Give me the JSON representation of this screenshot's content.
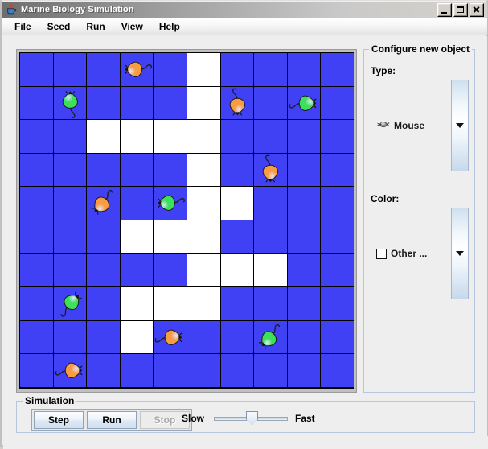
{
  "window": {
    "title": "Marine Biology Simulation",
    "icon": "java-coffee-cup-icon",
    "buttons": {
      "minimize": "minimize-button",
      "maximize": "maximize-button",
      "close": "close-button"
    }
  },
  "menubar": {
    "items": [
      {
        "label": "File"
      },
      {
        "label": "Seed"
      },
      {
        "label": "Run"
      },
      {
        "label": "View"
      },
      {
        "label": "Help"
      }
    ]
  },
  "grid": {
    "rows": 10,
    "cols": 10,
    "cell_color": "#4040f5",
    "empty_color": "#ffffff",
    "border_color": "#000000",
    "white_cells": [
      [
        0,
        5
      ],
      [
        1,
        5
      ],
      [
        2,
        2
      ],
      [
        2,
        3
      ],
      [
        2,
        4
      ],
      [
        2,
        5
      ],
      [
        3,
        5
      ],
      [
        4,
        5
      ],
      [
        4,
        6
      ],
      [
        5,
        3
      ],
      [
        5,
        4
      ],
      [
        5,
        5
      ],
      [
        6,
        5
      ],
      [
        6,
        6
      ],
      [
        6,
        7
      ],
      [
        7,
        3
      ],
      [
        7,
        4
      ],
      [
        7,
        5
      ],
      [
        8,
        3
      ]
    ],
    "fish": [
      {
        "row": 0,
        "col": 3,
        "color": "#f79c42",
        "direction": "west"
      },
      {
        "row": 1,
        "col": 1,
        "color": "#3ce05a",
        "direction": "north"
      },
      {
        "row": 1,
        "col": 6,
        "color": "#f79c42",
        "direction": "south"
      },
      {
        "row": 1,
        "col": 8,
        "color": "#3ce05a",
        "direction": "east"
      },
      {
        "row": 3,
        "col": 7,
        "color": "#f79c42",
        "direction": "south"
      },
      {
        "row": 4,
        "col": 2,
        "color": "#f79c42",
        "direction": "southwest"
      },
      {
        "row": 4,
        "col": 4,
        "color": "#3ce05a",
        "direction": "west"
      },
      {
        "row": 7,
        "col": 1,
        "color": "#3ce05a",
        "direction": "northeast"
      },
      {
        "row": 8,
        "col": 4,
        "color": "#f79c42",
        "direction": "east"
      },
      {
        "row": 8,
        "col": 7,
        "color": "#3ce05a",
        "direction": "southwest"
      },
      {
        "row": 9,
        "col": 1,
        "color": "#f79c42",
        "direction": "east"
      }
    ]
  },
  "config_panel": {
    "legend": "Configure new object",
    "type": {
      "label": "Type:",
      "selected": "Mouse",
      "icon": "mouse-icon"
    },
    "color": {
      "label": "Color:",
      "selected": "Other ...",
      "swatch": "#ffffff"
    }
  },
  "simulation_panel": {
    "legend": "Simulation",
    "buttons": [
      {
        "label": "Step",
        "enabled": true
      },
      {
        "label": "Run",
        "enabled": true
      },
      {
        "label": "Stop",
        "enabled": false
      }
    ],
    "speed": {
      "min_label": "Slow",
      "max_label": "Fast",
      "value_percent": 52
    }
  }
}
